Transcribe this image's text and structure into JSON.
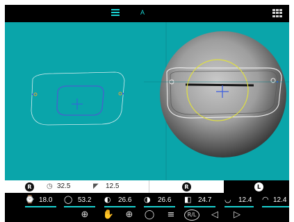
{
  "topbar": {
    "menu_icon": "hamburger-icon",
    "mode_label": "A",
    "grid_icon": "grid-icon"
  },
  "info": {
    "left_side_badge": "R",
    "param1_value": "32.5",
    "param2_value": "12.5",
    "mid_side_badge": "R",
    "right_side_badge": "L"
  },
  "measurements": [
    {
      "icon": "bridge-icon",
      "value": "18.0"
    },
    {
      "icon": "lens-width-icon",
      "value": "53.2"
    },
    {
      "icon": "half-lens-icon",
      "value": "26.6"
    },
    {
      "icon": "half-lens-alt-icon",
      "value": "26.6"
    },
    {
      "icon": "lens-height-icon",
      "value": "24.7"
    },
    {
      "icon": "segment-height-icon",
      "value": "12.4"
    },
    {
      "icon": "segment-height-alt-icon",
      "value": "12.4"
    }
  ],
  "tools": [
    {
      "name": "block-tool-icon"
    },
    {
      "name": "hand-drag-icon"
    },
    {
      "name": "center-tool-icon"
    },
    {
      "name": "shape-edit-icon"
    },
    {
      "name": "list-icon"
    },
    {
      "name": "rl-swap-icon",
      "label": "R/L"
    },
    {
      "name": "previous-icon"
    },
    {
      "name": "next-icon"
    }
  ],
  "colors": {
    "accent": "#19d3d3",
    "canvas": "#0aa5aa",
    "crosshair": "#3a5ce0",
    "yellow_circle": "#e0e040"
  }
}
